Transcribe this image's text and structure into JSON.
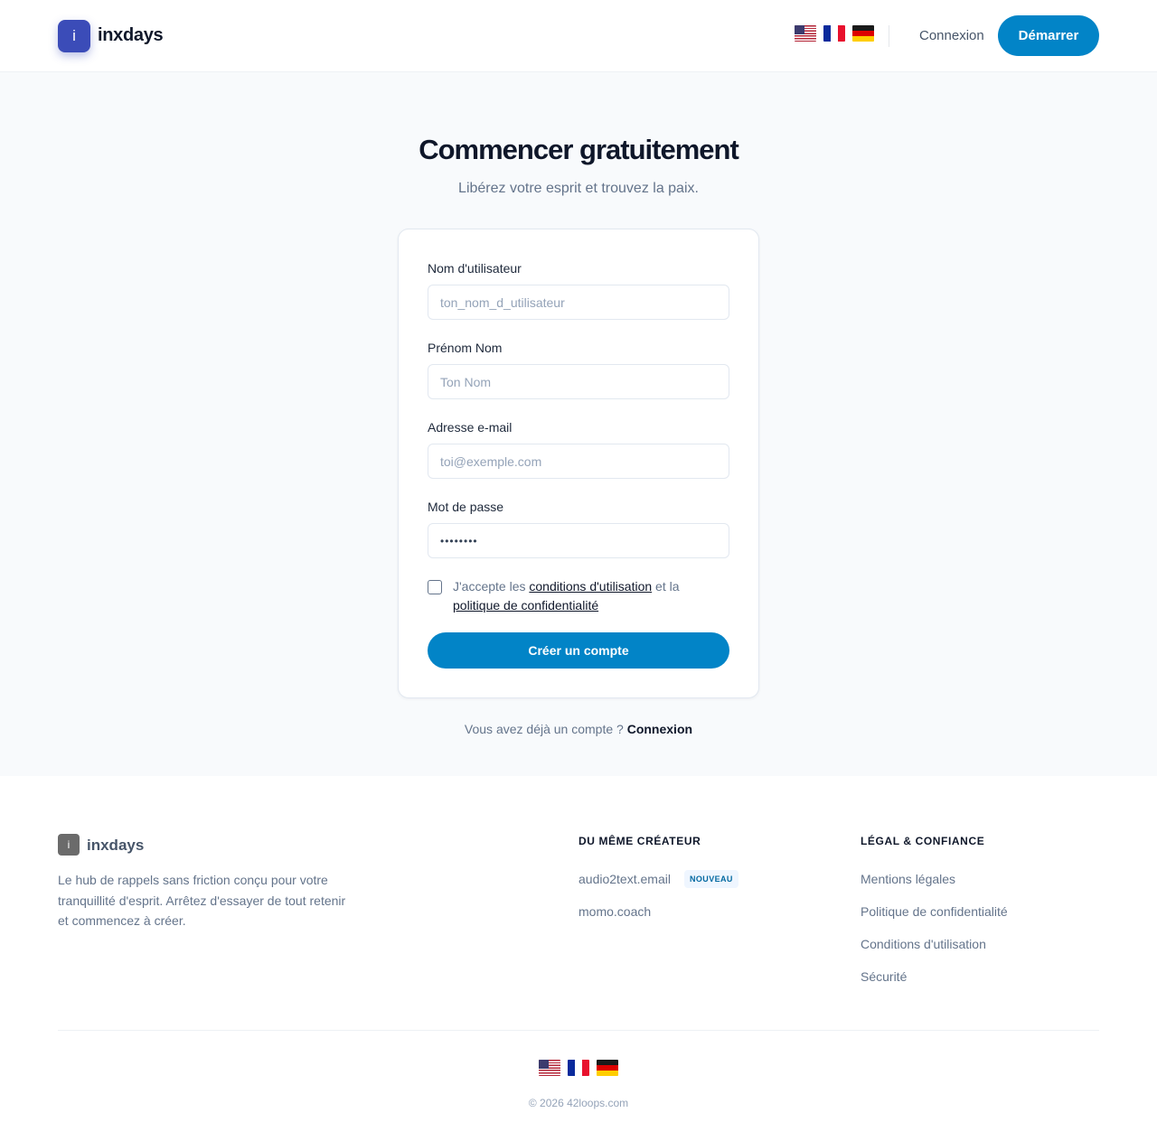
{
  "header": {
    "logo_letter": "i",
    "brand": "inxdays",
    "flags": [
      "us-flag-icon",
      "fr-flag-icon",
      "de-flag-icon"
    ],
    "login_label": "Connexion",
    "start_label": "Démarrer"
  },
  "main": {
    "title": "Commencer gratuitement",
    "subtitle": "Libérez votre esprit et trouvez la paix.",
    "form": {
      "username_label": "Nom d'utilisateur",
      "username_placeholder": "ton_nom_d_utilisateur",
      "fullname_label": "Prénom Nom",
      "fullname_placeholder": "Ton Nom",
      "email_label": "Adresse e-mail",
      "email_placeholder": "toi@exemple.com",
      "password_label": "Mot de passe",
      "password_value": "••••••••",
      "terms_prefix": "J'accepte les ",
      "terms_link": "conditions d'utilisation",
      "terms_middle": " et la ",
      "privacy_link": "politique de confidentialité",
      "submit_label": "Créer un compte"
    },
    "already_text": "Vous avez déjà un compte ?",
    "already_link": "Connexion"
  },
  "footer": {
    "logo_letter": "i",
    "brand": "inxdays",
    "description": "Le hub de rappels sans friction conçu pour votre tranquillité d'esprit. Arrêtez d'essayer de tout retenir et commencez à créer.",
    "creator_heading": "DU MÊME CRÉATEUR",
    "creator_links": [
      "audio2text.email",
      "momo.coach"
    ],
    "new_badge": "NOUVEAU",
    "legal_heading": "LÉGAL & CONFIANCE",
    "legal_links": [
      "Mentions légales",
      "Politique de confidentialité",
      "Conditions d'utilisation",
      "Sécurité"
    ],
    "copyright": "© 2026 42loops.com"
  },
  "colors": {
    "primary": "#0284c7",
    "logo": "#3b4cb8",
    "text": "#0f172a",
    "muted": "#64748b"
  }
}
